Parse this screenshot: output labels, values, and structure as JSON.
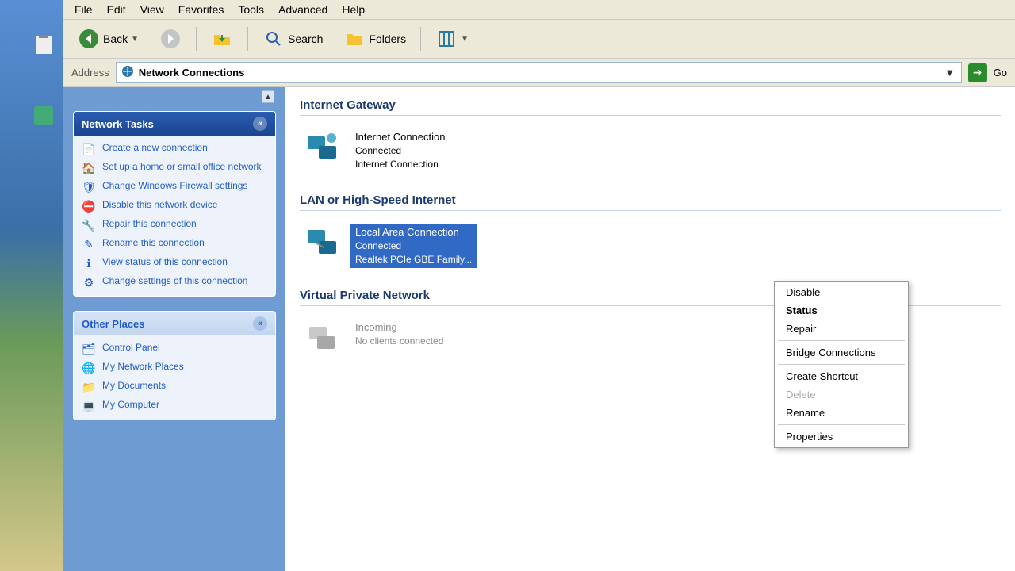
{
  "menu": [
    "File",
    "Edit",
    "View",
    "Favorites",
    "Tools",
    "Advanced",
    "Help"
  ],
  "toolbar": {
    "back": "Back",
    "search": "Search",
    "folders": "Folders"
  },
  "address": {
    "label": "Address",
    "value": "Network Connections",
    "go": "Go"
  },
  "sidebar": {
    "tasks_title": "Network Tasks",
    "tasks": [
      "Create a new connection",
      "Set up a home or small office network",
      "Change Windows Firewall settings",
      "Disable this network device",
      "Repair this connection",
      "Rename this connection",
      "View status of this connection",
      "Change settings of this connection"
    ],
    "places_title": "Other Places",
    "places": [
      "Control Panel",
      "My Network Places",
      "My Documents",
      "My Computer"
    ]
  },
  "groups": {
    "gateway": {
      "title": "Internet Gateway",
      "item": {
        "name": "Internet Connection",
        "status": "Connected",
        "detail": "Internet Connection"
      }
    },
    "lan": {
      "title": "LAN or High-Speed Internet",
      "item": {
        "name": "Local Area Connection",
        "status": "Connected",
        "detail": "Realtek PCIe GBE Family..."
      }
    },
    "vpn": {
      "title": "Virtual Private Network",
      "item": {
        "name": "Incoming",
        "status": "No clients connected",
        "detail": ""
      }
    }
  },
  "context": {
    "items": [
      "Disable",
      "Status",
      "Repair",
      "Bridge Connections",
      "Create Shortcut",
      "Delete",
      "Rename",
      "Properties"
    ]
  }
}
